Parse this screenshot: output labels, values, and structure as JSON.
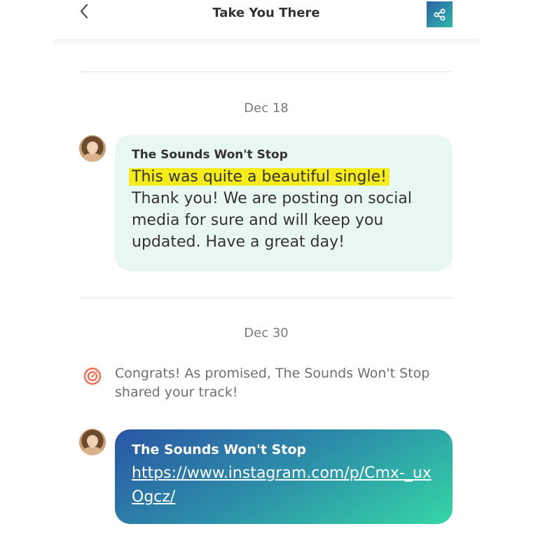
{
  "header": {
    "title": "Take You There",
    "back_icon": "chevron-left-icon",
    "share_icon": "share-icon"
  },
  "thread": [
    {
      "date": "Dec 18",
      "message": {
        "sender": "The Sounds Won't Stop",
        "highlighted_text": "This was quite a beautiful single!",
        "text": "Thank you! We are posting on social media for sure and will keep you updated. Have a great day!"
      }
    },
    {
      "date": "Dec 30",
      "event": {
        "icon": "target-icon",
        "text": "Congrats! As promised, The Sounds Won't Stop shared your track!"
      },
      "message": {
        "sender": "The Sounds Won't Stop",
        "link": "https://www.instagram.com/p/Cmx-_uxOgcz/"
      }
    }
  ],
  "colors": {
    "accent_start": "#2a56a4",
    "accent_end": "#35d6a5",
    "light_bubble": "#e9f7f3",
    "highlight": "#f5ec1a"
  }
}
